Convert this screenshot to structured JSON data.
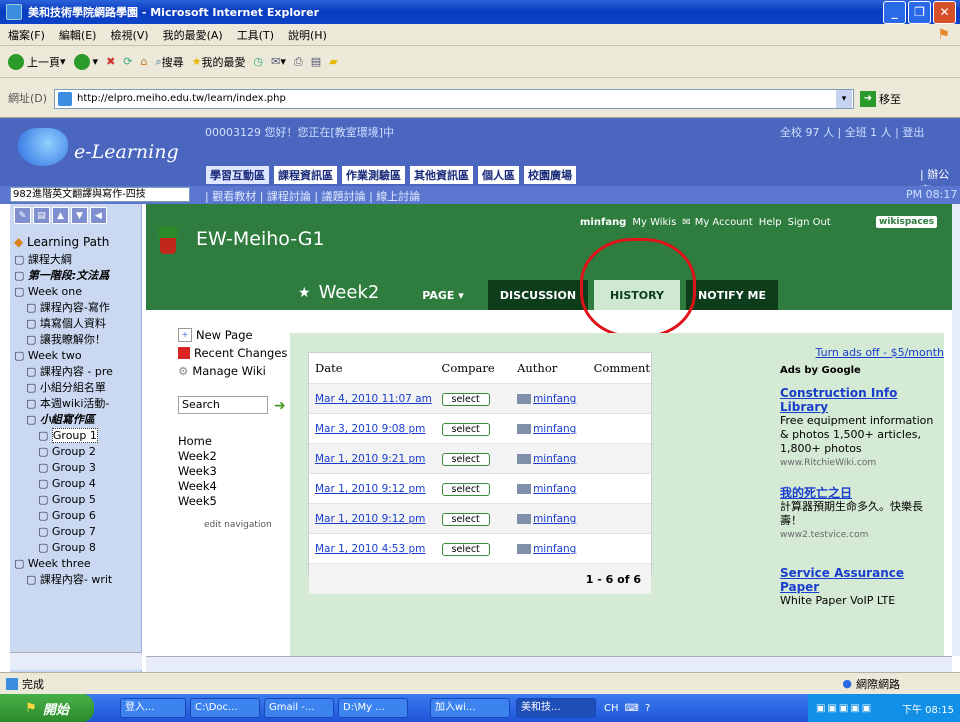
{
  "window": {
    "title": "美和技術學院網路學園 - Microsoft Internet Explorer"
  },
  "menubar": [
    "檔案(F)",
    "編輯(E)",
    "檢視(V)",
    "我的最愛(A)",
    "工具(T)",
    "說明(H)"
  ],
  "toolbar": {
    "back": "上一頁",
    "search": "搜尋",
    "favorites": "我的最愛"
  },
  "address": {
    "label": "網址(D)",
    "url": "http://elpro.meiho.edu.tw/learn/index.php",
    "go": "移至"
  },
  "lms": {
    "logo": "e-Learning",
    "welcome": "00003129 您好！您正在[教室環境]中",
    "online": "全校 97 人 | 全班 1 人 | 登出",
    "tabs": [
      "學習互動區",
      "課程資訊區",
      "作業測驗區",
      "其他資訊區",
      "個人區",
      "校園廣場"
    ],
    "office": "| 辦公室",
    "course": "982進階英文翻譯與寫作-四技",
    "sublinks": "| 觀看教材 | 課程討論 | 議題討論 | 線上討論",
    "clock": "PM 08:17"
  },
  "sidebar": {
    "items": [
      {
        "label": "Learning Path",
        "bold": false,
        "indent": 0
      },
      {
        "label": "課程大綱",
        "indent": 0
      },
      {
        "label": "第一階段:文法爲",
        "indent": 0,
        "bold": true
      },
      {
        "label": "Week one",
        "indent": 0
      },
      {
        "label": "課程內容-寫作",
        "indent": 1
      },
      {
        "label": "填寫個人資料",
        "indent": 1
      },
      {
        "label": "讓我瞭解你！",
        "indent": 1
      },
      {
        "label": "Week two",
        "indent": 0
      },
      {
        "label": "課程內容 - pre",
        "indent": 1
      },
      {
        "label": "小組分組名單",
        "indent": 1
      },
      {
        "label": "本週wiki活動-",
        "indent": 1
      },
      {
        "label": "小組寫作區",
        "indent": 1,
        "bold": true
      },
      {
        "label": "Group 1",
        "indent": 2,
        "selected": true
      },
      {
        "label": "Group 2",
        "indent": 2
      },
      {
        "label": "Group 3",
        "indent": 2
      },
      {
        "label": "Group 4",
        "indent": 2
      },
      {
        "label": "Group 5",
        "indent": 2
      },
      {
        "label": "Group 6",
        "indent": 2
      },
      {
        "label": "Group 7",
        "indent": 2
      },
      {
        "label": "Group 8",
        "indent": 2
      },
      {
        "label": "Week three",
        "indent": 0
      },
      {
        "label": "課程內容- writ",
        "indent": 1
      }
    ]
  },
  "wiki": {
    "title": "EW-Meiho-G1",
    "user": "minfang",
    "top_links": [
      "My Wikis",
      "My Account",
      "Help",
      "Sign Out"
    ],
    "brand": "wikispaces",
    "page_name": "Week2",
    "tabs": {
      "page": "PAGE ▾",
      "discussion": "DISCUSSION",
      "history": "HISTORY",
      "notify": "NOTIFY ME"
    },
    "nav": [
      "New Page",
      "Recent Changes",
      "Manage Wiki"
    ],
    "search_value": "Search",
    "pages": [
      "Home",
      "Week2",
      "Week3",
      "Week4",
      "Week5"
    ],
    "edit_nav": "edit navigation",
    "history": {
      "headers": [
        "Date",
        "Compare",
        "Author",
        "Comment"
      ],
      "rows": [
        {
          "date": "Mar 4, 2010 11:07 am",
          "compare": "select",
          "author": "minfang"
        },
        {
          "date": "Mar 3, 2010 9:08 pm",
          "compare": "select",
          "author": "minfang"
        },
        {
          "date": "Mar 1, 2010 9:21 pm",
          "compare": "select",
          "author": "minfang"
        },
        {
          "date": "Mar 1, 2010 9:12 pm",
          "compare": "select",
          "author": "minfang"
        },
        {
          "date": "Mar 1, 2010 9:12 pm",
          "compare": "select",
          "author": "minfang"
        },
        {
          "date": "Mar 1, 2010 4:53 pm",
          "compare": "select",
          "author": "minfang"
        }
      ],
      "pagination": "1 - 6 of 6"
    }
  },
  "ads": {
    "turn_off": "Turn ads off - $5/month",
    "ads_by": "Ads by Google",
    "items": [
      {
        "title": "Construction Info Library",
        "body": "Free equipment information & photos 1,500+ articles, 1,800+ photos",
        "url": "www.RitchieWiki.com"
      },
      {
        "title": "我的死亡之日",
        "body": "計算器預期生命多久。快樂長壽！",
        "url": "www2.testvice.com"
      },
      {
        "title": "Service Assurance Paper",
        "body": "White Paper VoIP LTE",
        "url": ""
      }
    ]
  },
  "statusbar": {
    "left": "完成",
    "right": "網際網路"
  },
  "taskbar": {
    "start": "開始",
    "tasks": [
      "登入...",
      "C:\\Doc...",
      "Gmail -...",
      "D:\\My ...",
      "加入wi...",
      "美和技..."
    ],
    "tray_lang": "CH",
    "clock": "下午 08:15"
  }
}
